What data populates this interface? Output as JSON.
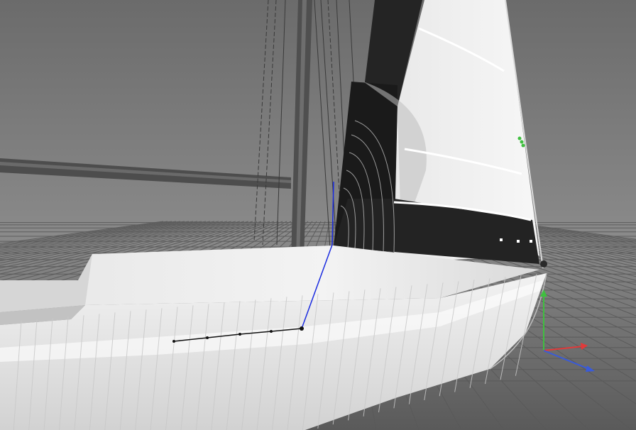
{
  "viewport": {
    "background_top": "#6f6f6f",
    "background_bottom": "#4a4a4a",
    "floor_grid_color": "#595959"
  },
  "model": {
    "hull_color": "#ededed",
    "sail_color": "#f4f4f4",
    "sail_panel_dark": "#1e1e1e",
    "mast_color": "#505050"
  },
  "gizmo": {
    "x_axis_color": "#e03a3a",
    "y_axis_color": "#3fbf3f",
    "z_axis_color": "#3a5bd9",
    "selection_line_color": "#1a2be0"
  }
}
